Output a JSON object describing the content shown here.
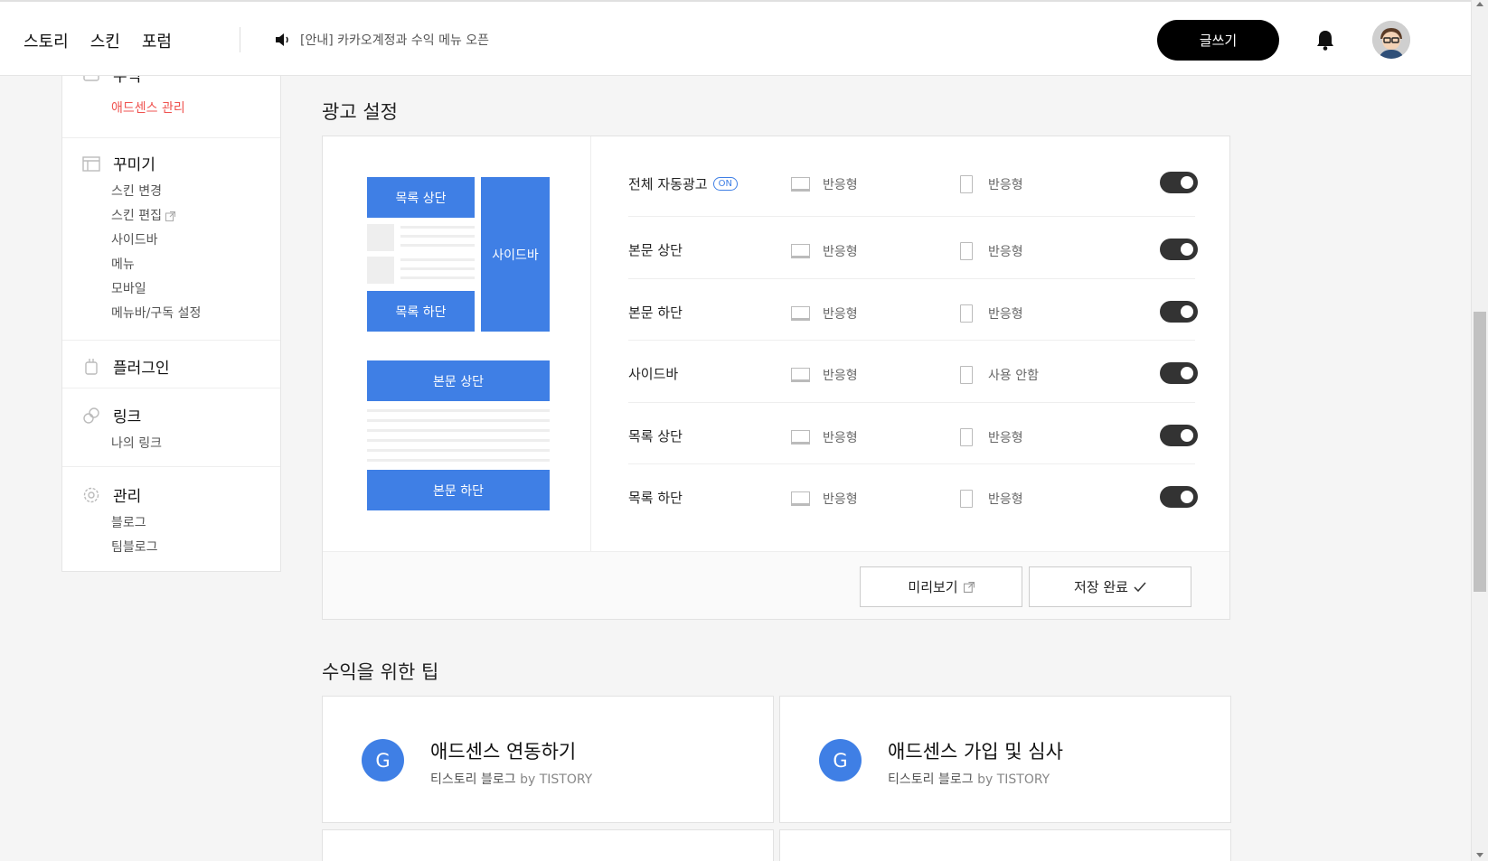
{
  "nav": {
    "links": [
      "스토리",
      "스킨",
      "포럼"
    ],
    "notice": "[안내] 카카오계정과 수익 메뉴 오픈",
    "write_label": "글쓰기"
  },
  "sidebar": {
    "top_partial_label": "수익",
    "top_active_item": "애드센스 관리",
    "sections": [
      {
        "title": "꾸미기",
        "icon": "layout-icon",
        "items": [
          "스킨 변경",
          "스킨 편집",
          "사이드바",
          "메뉴",
          "모바일",
          "메뉴바/구독 설정"
        ]
      },
      {
        "title": "플러그인",
        "icon": "plugin-icon",
        "items": []
      },
      {
        "title": "링크",
        "icon": "link-icon",
        "items": [
          "나의 링크"
        ]
      },
      {
        "title": "관리",
        "icon": "gear-icon",
        "items": [
          "블로그",
          "팀블로그"
        ]
      }
    ]
  },
  "ad_settings": {
    "title": "광고 설정",
    "preview_blocks": {
      "list_top": "목록 상단",
      "sidebar": "사이드바",
      "list_bottom": "목록 하단",
      "body_top": "본문 상단",
      "body_bottom": "본문 하단"
    },
    "rows": [
      {
        "name": "전체 자동광고",
        "badge": "ON",
        "pc": "반응형",
        "mobile": "반응형",
        "enabled": true
      },
      {
        "name": "본문 상단",
        "pc": "반응형",
        "mobile": "반응형",
        "enabled": true
      },
      {
        "name": "본문 하단",
        "pc": "반응형",
        "mobile": "반응형",
        "enabled": true
      },
      {
        "name": "사이드바",
        "pc": "반응형",
        "mobile": "사용 안함",
        "enabled": true
      },
      {
        "name": "목록 상단",
        "pc": "반응형",
        "mobile": "반응형",
        "enabled": true
      },
      {
        "name": "목록 하단",
        "pc": "반응형",
        "mobile": "반응형",
        "enabled": true
      }
    ],
    "preview_button": "미리보기",
    "save_button": "저장 완료"
  },
  "tips": {
    "title": "수익을 위한 팁",
    "cards": [
      {
        "logo": "G",
        "title": "애드센스 연동하기",
        "source": "티스토리 블로그",
        "by": "by TISTORY"
      },
      {
        "logo": "G",
        "title": "애드센스 가입 및 심사",
        "source": "티스토리 블로그",
        "by": "by TISTORY"
      }
    ]
  },
  "colors": {
    "accent": "#3f7fe5",
    "active_red": "#ef5350",
    "toggle_on": "#333333"
  }
}
